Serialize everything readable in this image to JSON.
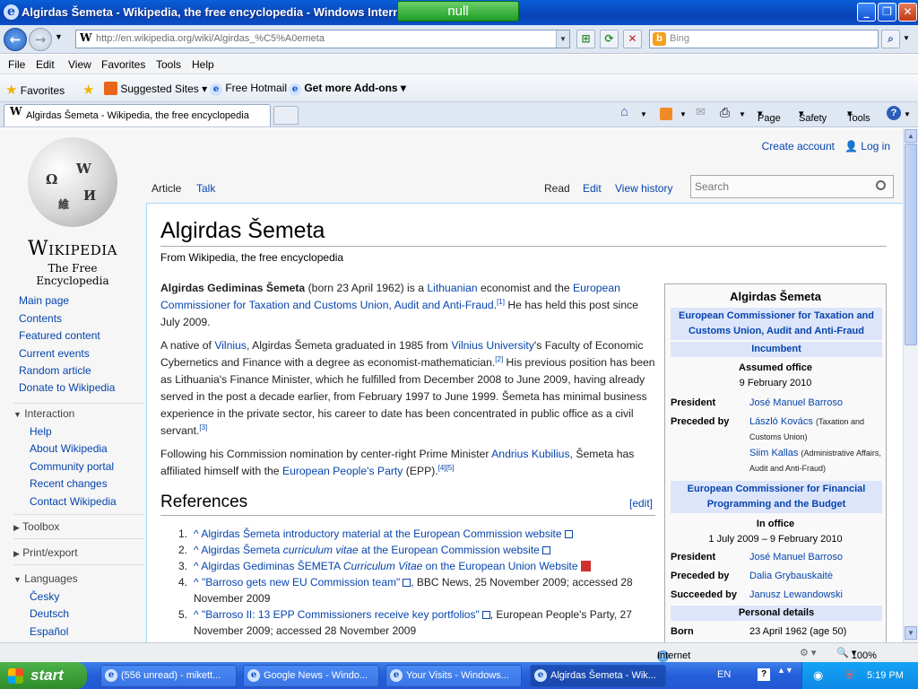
{
  "window": {
    "title": "Algirdas Šemeta - Wikipedia, the free encyclopedia - Windows Intern",
    "overlay_label": "null",
    "minimize": "_",
    "restore": "❐",
    "close": "✕"
  },
  "address": {
    "url": "http://en.wikipedia.org/wiki/Algirdas_%C5%A0emeta",
    "search_placeholder": "Bing"
  },
  "menu": [
    "File",
    "Edit",
    "View",
    "Favorites",
    "Tools",
    "Help"
  ],
  "favorites_bar": {
    "favorites": "Favorites",
    "suggested": "Suggested Sites",
    "hotmail": "Free Hotmail",
    "addons": "Get more Add-ons"
  },
  "tab": {
    "label": "Algirdas Šemeta - Wikipedia, the free encyclopedia"
  },
  "command_bar": {
    "page": "Page",
    "safety": "Safety",
    "tools": "Tools"
  },
  "wiki": {
    "wordmark": "Wikipedia",
    "tagline": "The Free Encyclopedia",
    "create_account": "Create account",
    "log_in": "Log in",
    "tabs": {
      "article": "Article",
      "talk": "Talk",
      "read": "Read",
      "edit": "Edit",
      "history": "View history"
    },
    "search_placeholder": "Search",
    "nav": [
      "Main page",
      "Contents",
      "Featured content",
      "Current events",
      "Random article",
      "Donate to Wikipedia"
    ],
    "interaction_header": "Interaction",
    "interaction": [
      "Help",
      "About Wikipedia",
      "Community portal",
      "Recent changes",
      "Contact Wikipedia"
    ],
    "toolbox": "Toolbox",
    "print_export": "Print/export",
    "languages_header": "Languages",
    "languages": [
      "Česky",
      "Deutsch",
      "Español"
    ]
  },
  "article": {
    "title": "Algirdas Šemeta",
    "from": "From Wikipedia, the free encyclopedia",
    "p1": {
      "bold": "Algirdas Gediminas Šemeta",
      "t1": " (born 23 April 1962) is a ",
      "l1": "Lithuanian",
      "t2": " economist and the ",
      "l2": "European Commissioner for Taxation and Customs Union, Audit and Anti-Fraud",
      "s1": "[1]",
      "t3": " He has held this post since July 2009."
    },
    "p2": {
      "t1": "A native of ",
      "l1": "Vilnius",
      "t2": ", Algirdas Šemeta graduated in 1985 from ",
      "l2": "Vilnius University",
      "t3": "'s Faculty of Economic Cybernetics and Finance with a degree as economist-mathematician.",
      "s1": "[2]",
      "t4": " His previous position has been as Lithuania's Finance Minister, which he fulfilled from December 2008 to June 2009, having already served in the post a decade earlier, from February 1997 to June 1999. Šemeta has minimal business experience in the private sector, his career to date has been concentrated in public office as a civil servant.",
      "s2": "[3]"
    },
    "p3": {
      "t1": "Following his Commission nomination by center-right Prime Minister ",
      "l1": "Andrius Kubilius",
      "t2": ", Šemeta has affiliated himself with the ",
      "l2": "European People's Party",
      "t3": " (EPP).",
      "s1": "[4][5]"
    },
    "references_heading": "References",
    "edit_link": "[edit]",
    "references": [
      {
        "num": "1.",
        "caret": "^",
        "link_a": "Algirdas Šemeta introductory material at the European Commission website",
        "link_i": "",
        "link_b": "",
        "rest": ""
      },
      {
        "num": "2.",
        "caret": "^",
        "link_a": "Algirdas Šemeta ",
        "link_i": "curriculum vitae",
        "link_b": " at the European Commission website",
        "rest": ""
      },
      {
        "num": "3.",
        "caret": "^",
        "link_a": "Algirdas Gediminas ŠEMETA ",
        "link_i": "Curriculum Vitae",
        "link_b": " on the European Union Website",
        "rest": ""
      },
      {
        "num": "4.",
        "caret": "^",
        "link_a": "\"Barroso gets new EU Commission team\"",
        "link_i": "",
        "link_b": "",
        "rest": ", BBC News, 25 November 2009; accessed 28 November 2009"
      },
      {
        "num": "5.",
        "caret": "^",
        "link_a": "\"Barroso II: 13 EPP Commissioners receive key portfolios\"",
        "link_i": "",
        "link_b": "",
        "rest": ", European People's Party, 27 November 2009; accessed 28 November 2009"
      }
    ]
  },
  "infobox": {
    "name": "Algirdas Šemeta",
    "office1": "European Commissioner for Taxation and Customs Union, Audit and Anti-Fraud",
    "incumbent": "Incumbent",
    "assumed_office": "Assumed office",
    "assumed_date": "9 February 2010",
    "president_label": "President",
    "president1": "José Manuel Barroso",
    "preceded_label": "Preceded by",
    "preceded1a": "László Kovács",
    "preceded1a_note": "(Taxation and Customs Union)",
    "preceded1b": "Siim Kallas",
    "preceded1b_note": "(Administrative Affairs, Audit and Anti-Fraud)",
    "office2": "European Commissioner for Financial Programming and the Budget",
    "in_office": "In office",
    "in_office_dates": "1 July 2009 – 9 February 2010",
    "president2": "José Manuel Barroso",
    "preceded2": "Dalia Grybauskaitė",
    "succeeded_label": "Succeeded by",
    "succeeded2": "Janusz Lewandowski",
    "personal": "Personal details",
    "born_label": "Born",
    "born_value": "23 April 1962 (age 50)"
  },
  "status": {
    "zone": "Internet",
    "zoom": "100%"
  },
  "taskbar": {
    "start": "start",
    "tasks": [
      "(556 unread) - mikett...",
      "Google News - Windo...",
      "Your Visits - Windows...",
      "Algirdas Šemeta - Wik..."
    ],
    "lang": "EN",
    "clock": "5:19 PM"
  }
}
